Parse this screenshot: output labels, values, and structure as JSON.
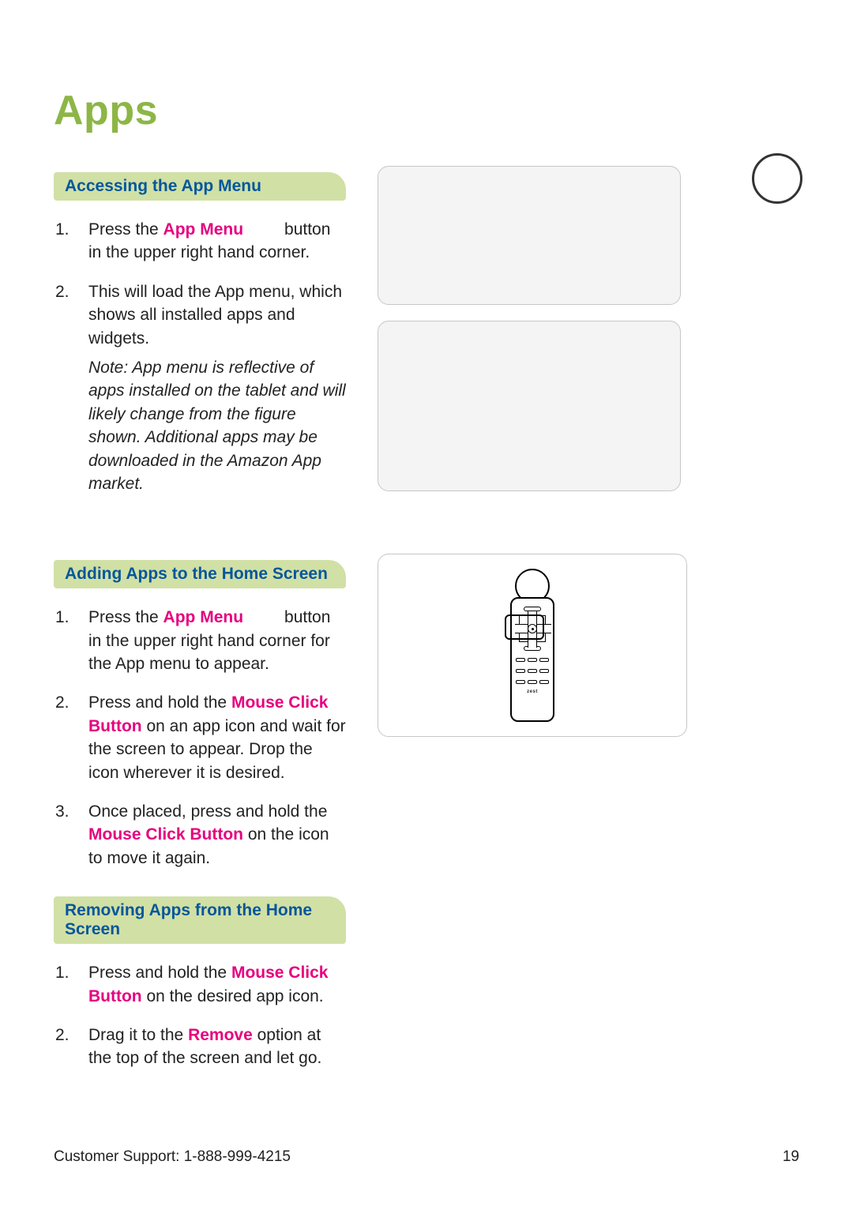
{
  "title": "Apps",
  "sections": {
    "accessing": {
      "heading": "Accessing the App Menu",
      "steps": [
        {
          "pre": "Press the ",
          "hilite": "App Menu",
          "mid": "",
          "gap": true,
          "post": "button in the upper right hand corner."
        },
        {
          "pre": "This will load the App menu, which shows all installed apps and widgets.",
          "hilite": "",
          "post": ""
        }
      ],
      "note": "Note: App menu is reflective of apps installed on the tablet and will likely change from the figure shown. Additional apps may be downloaded in the Amazon App market."
    },
    "adding": {
      "heading": "Adding Apps to the Home Screen",
      "steps": [
        {
          "pre": "Press the ",
          "hilite": "App Menu",
          "mid": "",
          "gap": true,
          "post": "button in the upper right hand corner for the App menu to appear."
        },
        {
          "pre": "Press and hold the ",
          "hilite": "Mouse Click Button",
          "post": " on an app icon and wait for the screen to appear. Drop the icon wherever it is desired."
        },
        {
          "pre": "Once placed, press and hold the ",
          "hilite": "Mouse Click Button",
          "post": " on the icon to move it again."
        }
      ]
    },
    "removing": {
      "heading": "Removing Apps from the Home Screen",
      "steps": [
        {
          "pre": "Press and hold the ",
          "hilite": "Mouse Click Button",
          "post": " on the desired app icon."
        },
        {
          "pre": "Drag it to the ",
          "hilite": "Remove",
          "post": " option at the top of the screen and let go."
        }
      ]
    }
  },
  "remote_brand": "zest",
  "footer": {
    "support": "Customer Support: 1-888-999-4215",
    "page_number": "19"
  }
}
